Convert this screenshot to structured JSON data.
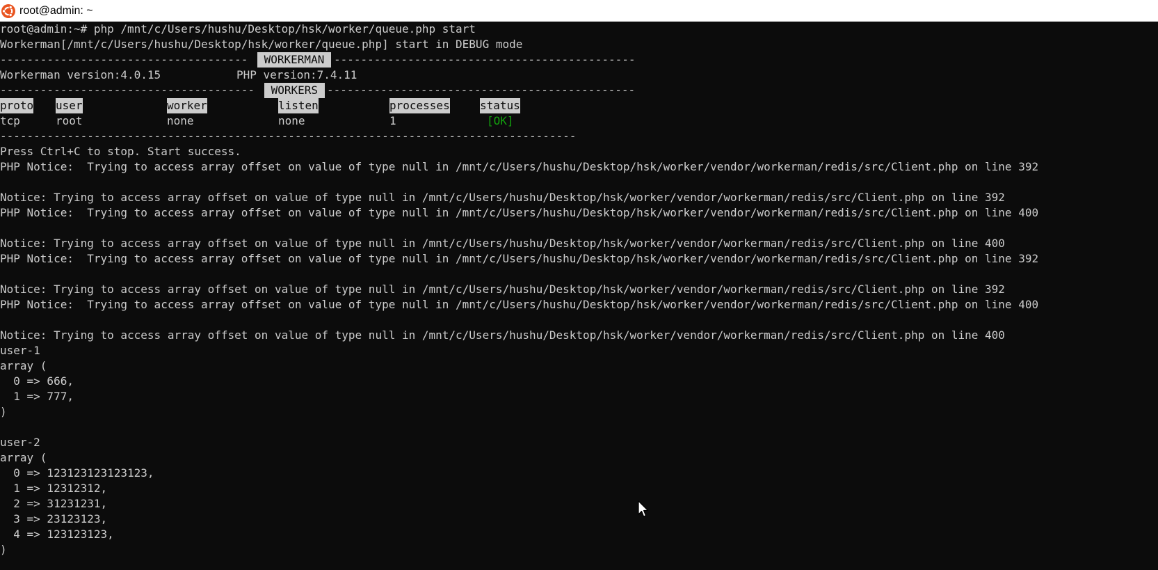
{
  "window": {
    "title": "root@admin: ~",
    "icon": "ubuntu-logo-icon",
    "icon_color": "#e95420"
  },
  "colors": {
    "background": "#0c0c0c",
    "foreground": "#cccccc",
    "ok": "#13a10e"
  },
  "terminal": {
    "prompt_line": "root@admin:~# php /mnt/c/Users/hushu/Desktop/hsk/worker/queue.php start",
    "debug_line": "Workerman[/mnt/c/Users/hushu/Desktop/hsk/worker/queue.php] start in DEBUG mode",
    "sep1_left": "-------------------------------------",
    "sep1_label": " WORKERMAN ",
    "sep1_right": "---------------------------------------------",
    "workerman_version": "Workerman version:4.0.15",
    "php_version": "PHP version:7.4.11",
    "sep2_left": "--------------------------------------",
    "sep2_label": " WORKERS ",
    "sep2_right": "----------------------------------------------",
    "workers_table": {
      "headers": [
        "proto",
        "user",
        "worker",
        "listen",
        "processes",
        "status"
      ],
      "row": {
        "proto": "tcp",
        "user": "root",
        "worker": "none",
        "listen": "none",
        "processes": "1",
        "status": "[OK]"
      }
    },
    "sep3": "--------------------------------------------------------------------------------------",
    "start_success": "Press Ctrl+C to stop. Start success.",
    "notices": [
      "PHP Notice:  Trying to access array offset on value of type null in /mnt/c/Users/hushu/Desktop/hsk/worker/vendor/workerman/redis/src/Client.php on line 392",
      "",
      "Notice: Trying to access array offset on value of type null in /mnt/c/Users/hushu/Desktop/hsk/worker/vendor/workerman/redis/src/Client.php on line 392",
      "PHP Notice:  Trying to access array offset on value of type null in /mnt/c/Users/hushu/Desktop/hsk/worker/vendor/workerman/redis/src/Client.php on line 400",
      "",
      "Notice: Trying to access array offset on value of type null in /mnt/c/Users/hushu/Desktop/hsk/worker/vendor/workerman/redis/src/Client.php on line 400",
      "PHP Notice:  Trying to access array offset on value of type null in /mnt/c/Users/hushu/Desktop/hsk/worker/vendor/workerman/redis/src/Client.php on line 392",
      "",
      "Notice: Trying to access array offset on value of type null in /mnt/c/Users/hushu/Desktop/hsk/worker/vendor/workerman/redis/src/Client.php on line 392",
      "PHP Notice:  Trying to access array offset on value of type null in /mnt/c/Users/hushu/Desktop/hsk/worker/vendor/workerman/redis/src/Client.php on line 400",
      "",
      "Notice: Trying to access array offset on value of type null in /mnt/c/Users/hushu/Desktop/hsk/worker/vendor/workerman/redis/src/Client.php on line 400"
    ],
    "dump_lines": [
      "user-1",
      "array (",
      "  0 => 666,",
      "  1 => 777,",
      ")",
      "",
      "user-2",
      "array (",
      "  0 => 123123123123123,",
      "  1 => 12312312,",
      "  2 => 31231231,",
      "  3 => 23123123,",
      "  4 => 123123123,",
      ")"
    ]
  },
  "cursor": {
    "icon": "mouse-pointer-icon"
  }
}
